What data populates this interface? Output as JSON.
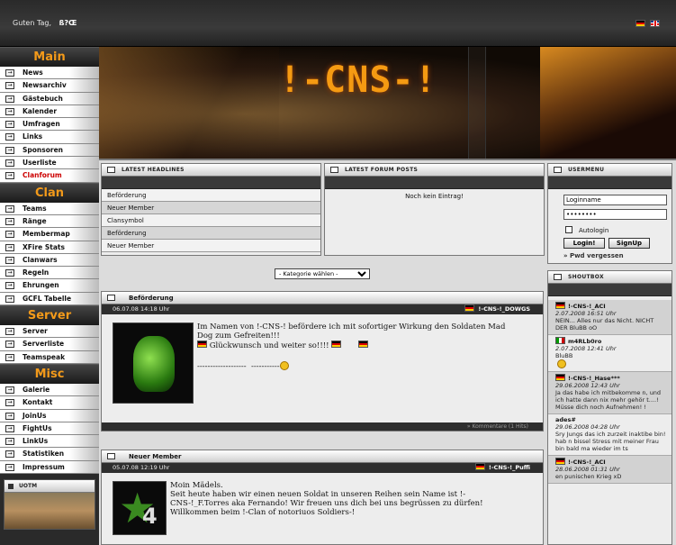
{
  "header": {
    "greeting": "Guten Tag,",
    "username": "ß?Œ",
    "languages": [
      "de-flag",
      "en-flag"
    ]
  },
  "sidebar": {
    "sections": [
      {
        "title": "Main",
        "items": [
          "News",
          "Newsarchiv",
          "Gästebuch",
          "Kalender",
          "Umfragen",
          "Links",
          "Sponsoren",
          "Userliste",
          "Clanforum"
        ]
      },
      {
        "title": "Clan",
        "items": [
          "Teams",
          "Ränge",
          "Membermap",
          "XFire Stats",
          "Clanwars",
          "Regeln",
          "Ehrungen",
          "GCFL Tabelle"
        ]
      },
      {
        "title": "Server",
        "items": [
          "Server",
          "Serverliste",
          "Teamspeak"
        ]
      },
      {
        "title": "Misc",
        "items": [
          "Galerie",
          "Kontakt",
          "JoinUs",
          "FightUs",
          "LinkUs",
          "Statistiken",
          "Impressum"
        ]
      }
    ],
    "active_item": "Clanforum",
    "uotm_title": "UOTM"
  },
  "banner": {
    "logo": "!-CNS-!"
  },
  "headlines": {
    "title": "LATEST HEADLINES",
    "items": [
      "Beförderung",
      "Neuer Member",
      "Clansymbol",
      "Beförderung",
      "Neuer Member"
    ]
  },
  "forum": {
    "title": "LATEST FORUM POSTS",
    "empty": "Noch kein Eintrag!"
  },
  "usermenu": {
    "title": "USERMENU",
    "login_value": "Loginname",
    "password_value": "••••••••",
    "autologin": "Autologin",
    "login_button": "Login!",
    "signup_button": "SignUp",
    "forgot": "» Pwd vergessen"
  },
  "category_select": "- Kategorie wählen -",
  "news": [
    {
      "title": "Beförderung",
      "date": "06.07.08 14:18 Uhr",
      "author": "!-CNS-!_DOWGS",
      "body1": "Im Namen von !-CNS-! befördere ich mit sofortiger Wirkung den Soldaten Mad Dog zum Gefreiten!!!",
      "body2": "Glückwunsch und weiter so!!!!",
      "body3": "-------------------",
      "body4": "-----------",
      "footer": "» Kommentare (1 Hits)"
    },
    {
      "title": "Neuer Member",
      "date": "05.07.08 12:19 Uhr",
      "author": "!-CNS-!_Puffi",
      "body1": "Moin Mädels.",
      "body2": "Seit heute haben wir einen neuen Soldat in unseren Reihen sein Name ist !-CNS-!_F.Torres aka Fernando! Wir freuen uns dich bei uns begrüssen zu dürfen!",
      "body3": "Willkommen beim !-Clan of notoriuos Soldiers-!"
    }
  ],
  "shoutbox": {
    "title": "SHOUTBOX",
    "entries": [
      {
        "name": "!-CNS-!_ACI",
        "date": "2.07.2008 16:51 Uhr",
        "msg": "NEIN... Alles nur das Nicht. NICHT DER BluBB oO",
        "flag": "de"
      },
      {
        "name": "m4RLb0ro",
        "date": "2.07.2008 12:41 Uhr",
        "msg": "BluBB",
        "flag": "it"
      },
      {
        "name": "!-CNS-!_Hase***",
        "date": "29.06.2008 12:43 Uhr",
        "msg": "Ja das habe ich mitbekomme n, und ich hatte dann nix mehr gehör t....! Müsse dich noch Aufnehmen! !",
        "flag": "de"
      },
      {
        "name": "ades#",
        "date": "29.06.2008 04:28 Uhr",
        "msg": "Sry Jungs das ich zurzeit inaktibe bin! hab n bissel Stress mit meiner Frau bin bald ma wieder im ts",
        "flag": ""
      },
      {
        "name": "!-CNS-!_ACI",
        "date": "28.06.2008 01:31 Uhr",
        "msg": "en punischen Krieg xD",
        "flag": "de"
      }
    ]
  },
  "colors": {
    "accent": "#f39a1a",
    "active_nav": "#cc0000",
    "dark_band": "#2e2e2e"
  }
}
